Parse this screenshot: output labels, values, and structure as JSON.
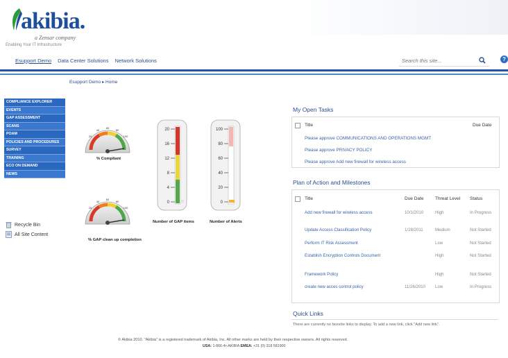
{
  "brand": {
    "name": "akibia.",
    "sub": "a Zensar company",
    "tagline": "Enabling Your IT Infrastructure"
  },
  "top_nav": [
    {
      "label": "Esupport Demo",
      "active": true
    },
    {
      "label": "Data Center Solutions",
      "active": false
    },
    {
      "label": "Network Solutions",
      "active": false
    }
  ],
  "search": {
    "placeholder": "Search this site..."
  },
  "breadcrumb": "Esupport Demo ▸ Home",
  "left_nav": [
    "COMPLIANCE EXPLORER",
    "EVENTS",
    "GAP ASSESSMENT",
    "SCANS",
    "POAM",
    "POLICIES AND PROCEDURES",
    "SURVEY",
    "TRAINING",
    "ECO ON DEMAND",
    "NEWS"
  ],
  "util_links": {
    "recycle": "Recycle Bin",
    "all_content": "All Site Content"
  },
  "gauges": {
    "compliant": {
      "label": "% Compliant",
      "ticks": [
        "60",
        "40",
        "80",
        "20",
        "100"
      ]
    },
    "gap_cleanup": {
      "label": "% GAP clean up completion",
      "ticks": [
        "60",
        "40",
        "80",
        "20",
        "100"
      ]
    }
  },
  "thermometers": {
    "gap": {
      "label": "Number of GAP items",
      "ticks": [
        "20",
        "16",
        "12",
        "8",
        "4",
        "0"
      ],
      "max": 20,
      "level": 0.05
    },
    "alerts": {
      "label": "Number of Alerts",
      "ticks": [
        "100",
        "80",
        "60",
        "40",
        "20",
        "0"
      ],
      "max": 100,
      "level": 0.02
    }
  },
  "open_tasks": {
    "title": "My Open Tasks",
    "col_title": "Title",
    "col_due": "Due Date",
    "items": [
      "Please approve COMMUNICATIONS AND OPERATIONS MGMT",
      "Please approve PRIVACY POLICY",
      "Please approve Add new firewall for wireless access"
    ]
  },
  "poam": {
    "title": "Plan of Action and Milestones",
    "headers": [
      "Title",
      "Due Date",
      "Threat Level",
      "Status"
    ],
    "rows": [
      {
        "title": "Add new firewall for wireless access",
        "due": "10/1/2010",
        "threat": "High",
        "status": "In Progress"
      },
      {
        "title": "Update Access Classification Policy",
        "due": "1/28/2011",
        "threat": "Medium",
        "status": "Not Started"
      },
      {
        "title": "Perform IT Risk Assessment",
        "due": "",
        "threat": "Low",
        "status": "Not Started"
      },
      {
        "title": "Establish Encryption Controls Document",
        "due": "",
        "threat": "High",
        "status": "Not Started"
      },
      {
        "title": "Framework Policy",
        "due": "",
        "threat": "High",
        "status": "Not Started"
      },
      {
        "title": "create new acces control policy",
        "due": "11/26/2010",
        "threat": "Low",
        "status": "In Progress"
      }
    ]
  },
  "quick_links": {
    "title": "Quick Links",
    "text": "There are currently no favorite links to display. To add a new link, click \"Add new link\"."
  },
  "footer": {
    "line1": "© Akibia 2010. \"Akibia\" is a registered trademark of Akibia, Inc. All other marks are held by their respective owners. All rights reserved.",
    "usa_label": "USA:",
    "usa_phone": "1-866-4r-AKIBIA",
    "emea_label": "EMEA:",
    "emea_phone": "+31 (0) 318 581900"
  },
  "colors": {
    "primary": "#1e56a6",
    "nav_blue": "#2a68c0",
    "link": "#3a62a6"
  }
}
